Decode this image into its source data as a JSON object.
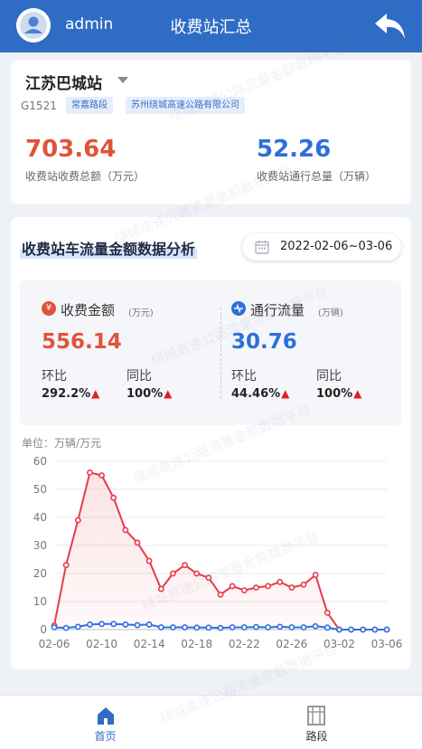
{
  "header": {
    "username": "admin",
    "title": "收费站汇总"
  },
  "station": {
    "name": "江苏巴城站",
    "road_code": "G1521",
    "tags": [
      "常嘉路段",
      "苏州绕城高速公路有限公司"
    ],
    "total_amount": "703.64",
    "total_amount_label": "收费站收费总额（万元）",
    "total_traffic": "52.26",
    "total_traffic_label": "收费站通行总量（万辆）"
  },
  "analysis": {
    "title": "收费站车流量金额数据分析",
    "date_range": "2022-02-06~03-06",
    "amount": {
      "icon_char": "¥",
      "title": "收费金额",
      "unit": "(万元)",
      "value": "556.14",
      "mom_label": "环比",
      "mom_value": "292.2%",
      "yoy_label": "同比",
      "yoy_value": "100%"
    },
    "traffic": {
      "title": "通行流量",
      "unit": "(万辆)",
      "value": "30.76",
      "mom_label": "环比",
      "mom_value": "44.46%",
      "yoy_label": "同比",
      "yoy_value": "100%"
    },
    "unit_note": "单位：万辆/万元"
  },
  "chart_data": {
    "type": "line",
    "x": [
      "02-06",
      "02-07",
      "02-08",
      "02-09",
      "02-10",
      "02-11",
      "02-12",
      "02-13",
      "02-14",
      "02-15",
      "02-16",
      "02-17",
      "02-18",
      "02-19",
      "02-20",
      "02-21",
      "02-22",
      "02-23",
      "02-24",
      "02-25",
      "02-26",
      "02-27",
      "02-28",
      "03-01",
      "03-02",
      "03-03",
      "03-04",
      "03-05",
      "03-06"
    ],
    "x_ticks": [
      "02-06",
      "02-10",
      "02-14",
      "02-18",
      "02-22",
      "02-26",
      "03-02",
      "03-06"
    ],
    "y_ticks": [
      0,
      10,
      20,
      30,
      40,
      50,
      60
    ],
    "ylim": [
      0,
      60
    ],
    "series": [
      {
        "color": "#e83a4c",
        "fill": true,
        "values": [
          1.5,
          23,
          39,
          56,
          55,
          47,
          35.5,
          31,
          24.5,
          14.5,
          20,
          23,
          20,
          18.5,
          12.5,
          15.5,
          14,
          15,
          15.5,
          17,
          15,
          16,
          19.5,
          6,
          0,
          0,
          0,
          0,
          0
        ]
      },
      {
        "color": "#2f6fe0",
        "fill": false,
        "values": [
          0.8,
          0.6,
          1,
          1.8,
          2,
          2,
          1.8,
          1.6,
          1.8,
          0.8,
          0.8,
          0.8,
          0.7,
          0.7,
          0.6,
          0.8,
          0.8,
          0.9,
          0.8,
          1,
          0.8,
          0.8,
          1.2,
          0.7,
          0,
          0,
          0,
          0,
          0
        ]
      }
    ],
    "grid": true
  },
  "watermark_text": "绕城高速公路流量金额数据平台",
  "tabbar": {
    "home": "首页",
    "road": "路段",
    "active_color": "#2f6dc4",
    "inactive_color": "#333333"
  }
}
